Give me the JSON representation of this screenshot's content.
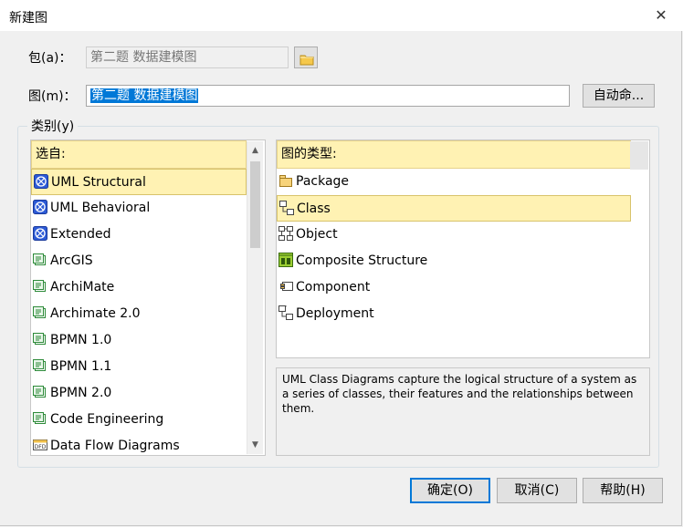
{
  "window": {
    "title": "新建图",
    "close_glyph": "✕"
  },
  "package": {
    "label": "包(a)：",
    "value": "第二题 数据建模图",
    "browse_icon": "folder-icon"
  },
  "diagram": {
    "label": "图(m)：",
    "value": "第二题 数据建模图",
    "auto_name_label": "自动命..."
  },
  "category_group": {
    "label": "类别(y)"
  },
  "left_list": {
    "header": "选自:",
    "items": [
      {
        "label": "UML Structural",
        "icon": "uml-icon",
        "selected": true
      },
      {
        "label": "UML Behavioral",
        "icon": "uml-icon",
        "selected": false
      },
      {
        "label": "Extended",
        "icon": "uml-icon",
        "selected": false
      },
      {
        "label": "ArcGIS",
        "icon": "technology-icon",
        "selected": false
      },
      {
        "label": "ArchiMate",
        "icon": "technology-icon",
        "selected": false
      },
      {
        "label": "Archimate 2.0",
        "icon": "technology-icon",
        "selected": false
      },
      {
        "label": "BPMN 1.0",
        "icon": "technology-icon",
        "selected": false
      },
      {
        "label": "BPMN 1.1",
        "icon": "technology-icon",
        "selected": false
      },
      {
        "label": "BPMN 2.0",
        "icon": "technology-icon",
        "selected": false
      },
      {
        "label": "Code Engineering",
        "icon": "technology-icon",
        "selected": false
      },
      {
        "label": "Data Flow Diagrams",
        "icon": "dfd-icon",
        "selected": false
      }
    ]
  },
  "right_list": {
    "header": "图的类型:",
    "items": [
      {
        "label": "Package",
        "icon": "package-icon",
        "selected": false
      },
      {
        "label": "Class",
        "icon": "class-icon",
        "selected": true
      },
      {
        "label": "Object",
        "icon": "object-icon",
        "selected": false
      },
      {
        "label": "Composite Structure",
        "icon": "composite-structure-icon",
        "selected": false
      },
      {
        "label": "Component",
        "icon": "component-icon",
        "selected": false
      },
      {
        "label": "Deployment",
        "icon": "deployment-icon",
        "selected": false
      }
    ]
  },
  "description": "UML Class Diagrams capture the logical structure of a system as a series of classes, their features and the relationships between them.",
  "buttons": {
    "ok": "确定(O)",
    "cancel": "取消(C)",
    "help": "帮助(H)"
  },
  "colors": {
    "selection_bg": "#fff2b3",
    "text_selection": "#0078d7"
  }
}
